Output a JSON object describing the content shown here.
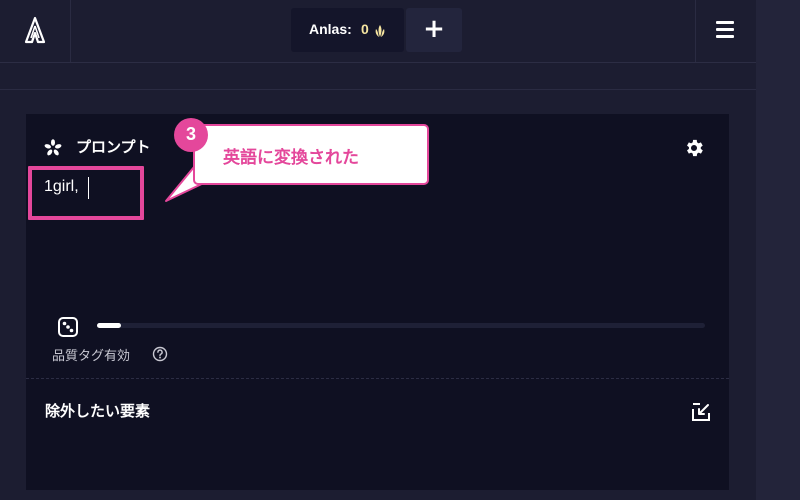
{
  "topbar": {
    "anlas_label": "Anlas:",
    "anlas_value": "0",
    "plus_label": "+"
  },
  "prompt": {
    "title": "プロンプト",
    "text": "1girl,",
    "quality_label": "品質タグ有効",
    "slider_level": 0.04
  },
  "negative": {
    "title": "除外したい要素"
  },
  "annotation": {
    "step_number": "3",
    "callout_text": "英語に変換された"
  },
  "icons": {
    "logo": "logo-icon",
    "anlas": "anlas-coin-icon",
    "menu": "hamburger-menu-icon",
    "prompt": "sparkle-icon",
    "settings": "gear-icon",
    "dice": "dice-icon",
    "help": "help-circle-icon",
    "negative": "import-icon"
  },
  "colors": {
    "accent": "#e4479b",
    "background": "#1c1d31",
    "panel": "#0f1022",
    "anlas_gold": "#f5e4a0"
  }
}
